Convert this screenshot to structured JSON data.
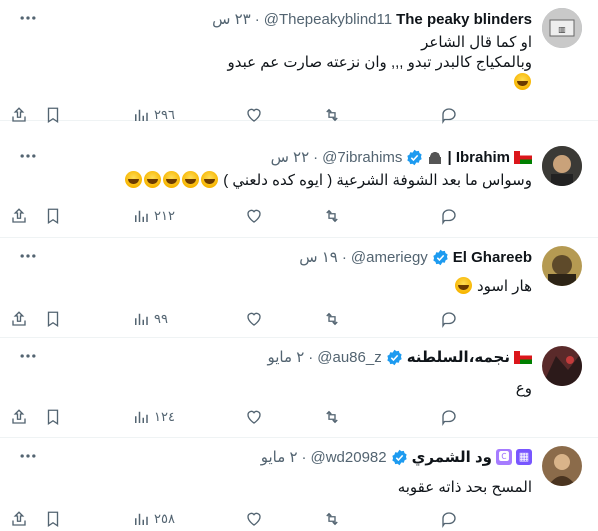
{
  "tweets": [
    {
      "name": "The peaky blinders",
      "handle": "@Thepeakyblind11",
      "time": "٢٣ س",
      "verified": false,
      "lines": [
        "او كما قال الشاعر",
        "وبالمكياج كالبدر تبدو ,,, وان نزعته صارت عم عبدو"
      ],
      "views": "٢٩٦",
      "avatar_color": "#9aa0a6"
    },
    {
      "name": "Ibrahim |",
      "handle": "@7ibrahims",
      "time": "٢٢ س",
      "verified": true,
      "lines": [
        "وسواس ما بعد الشوفة الشرعية ( ايوه كده دلعني )"
      ],
      "views": "٢١٢",
      "avatar_color": "#3b3a36"
    },
    {
      "name": "El Ghareeb",
      "handle": "@ameriegy",
      "time": "١٩ س",
      "verified": true,
      "lines": [
        "هار اسود"
      ],
      "views": "٩٩",
      "avatar_color": "#b59a52"
    },
    {
      "name": "نجمه،السلطنه",
      "handle": "@au86_z",
      "time": "٢ مايو",
      "verified": true,
      "lines": [
        "وع"
      ],
      "views": "١٢٤",
      "avatar_color": "#5a2a2a"
    },
    {
      "name": "ود الشمري",
      "handle": "@wd20982",
      "time": "٢ مايو",
      "verified": true,
      "badge": "🅲",
      "lines": [
        "المسح بحد ذاته عقوبه"
      ],
      "views": "٢٥٨",
      "avatar_color": "#8b6b4a"
    }
  ],
  "colors": {
    "verified": "#1d9bf0",
    "muted": "#536471",
    "divider": "#eff3f4"
  },
  "icons": [
    "more-icon",
    "reply-icon",
    "retweet-icon",
    "like-icon",
    "views-icon",
    "bookmark-icon",
    "share-icon",
    "verified-icon"
  ]
}
